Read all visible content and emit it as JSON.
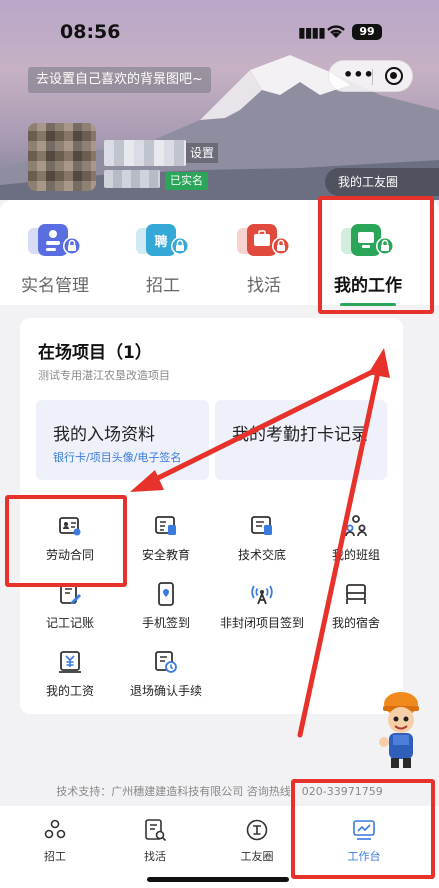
{
  "status_bar": {
    "time": "08:56",
    "battery": "99"
  },
  "header": {
    "bg_tip": "去设置自己喜欢的背景图吧~",
    "settings_label": "设置",
    "verified_badge": "已实名",
    "work_circle_button": "我的工友圈"
  },
  "tabs": [
    {
      "label": "实名管理",
      "icon": "id-card-lock-icon",
      "color": "#5b6ee1"
    },
    {
      "label": "招工",
      "icon": "recruit-lock-icon",
      "color": "#35a8d8"
    },
    {
      "label": "找活",
      "icon": "find-work-lock-icon",
      "color": "#e04a3c"
    },
    {
      "label": "我的工作",
      "icon": "my-work-lock-icon",
      "color": "#2aa55a",
      "active": true
    }
  ],
  "project": {
    "title": "在场项目（1）",
    "subtitle": "测试专用湛江农垦改造项目",
    "tiles": [
      {
        "title": "我的入场资料",
        "sub": "银行卡/项目头像/电子签名"
      },
      {
        "title": "我的考勤打卡记录",
        "sub": ""
      }
    ],
    "grid": [
      {
        "label": "劳动合同",
        "icon": "contract-icon"
      },
      {
        "label": "安全教育",
        "icon": "safety-education-icon"
      },
      {
        "label": "技术交底",
        "icon": "tech-briefing-icon"
      },
      {
        "label": "我的班组",
        "icon": "team-icon"
      },
      {
        "label": "记工记账",
        "icon": "timesheet-icon"
      },
      {
        "label": "手机签到",
        "icon": "phone-checkin-icon"
      },
      {
        "label": "非封闭项目签到",
        "icon": "signal-checkin-icon"
      },
      {
        "label": "我的宿舍",
        "icon": "dorm-bed-icon"
      },
      {
        "label": "我的工资",
        "icon": "salary-icon"
      },
      {
        "label": "退场确认手续",
        "icon": "exit-confirm-icon"
      }
    ]
  },
  "footer": {
    "support": "技术支持：广州穗建建造科技有限公司 咨询热线：020-33971759"
  },
  "nav": [
    {
      "label": "招工",
      "icon": "recruit-nav-icon"
    },
    {
      "label": "找活",
      "icon": "find-work-nav-icon"
    },
    {
      "label": "工友圈",
      "icon": "worker-circle-nav-icon"
    },
    {
      "label": "工作台",
      "icon": "workbench-nav-icon",
      "active": true
    }
  ],
  "colors": {
    "accent_green": "#2aa55a",
    "link_blue": "#3a7be0",
    "annotation_red": "#e6322a"
  }
}
